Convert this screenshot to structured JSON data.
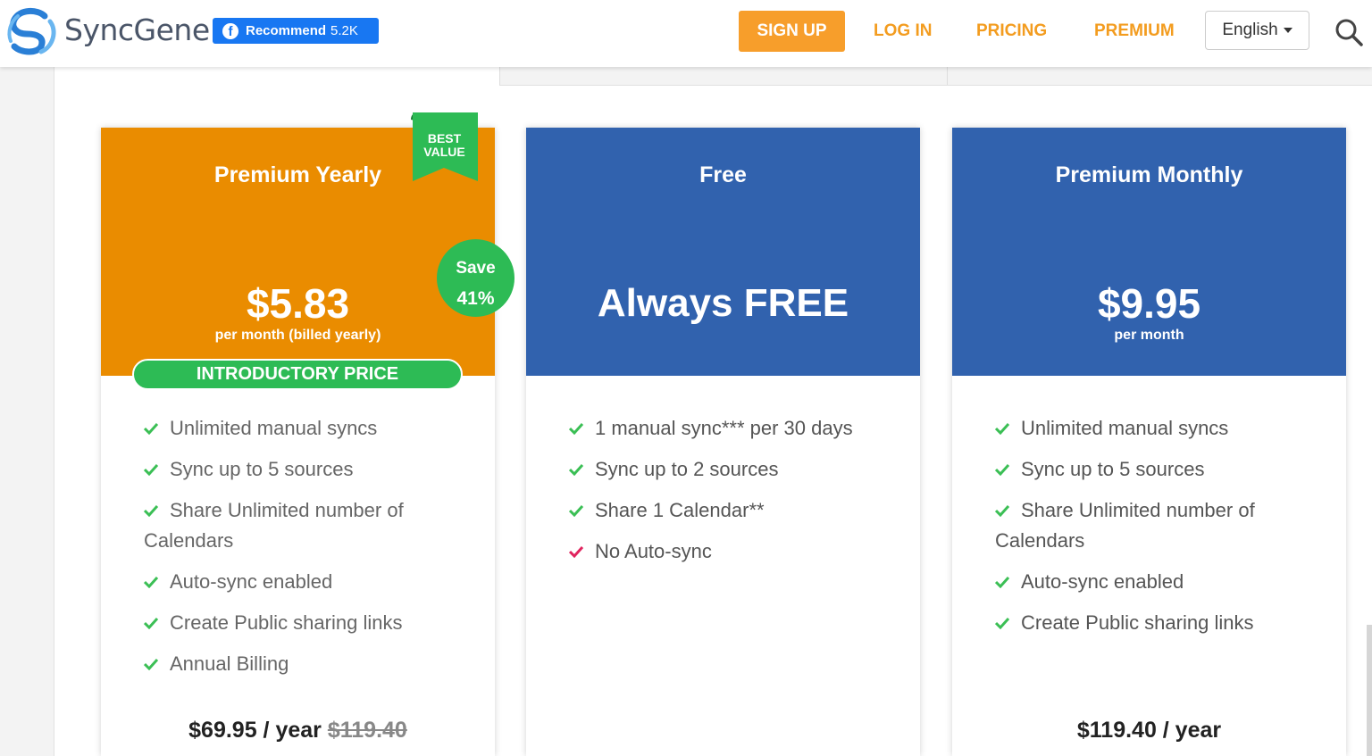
{
  "header": {
    "brand": "SyncGene",
    "recommend_label": "Recommend",
    "recommend_count": "5.2K",
    "signup_label": "SIGN UP",
    "login_label": "LOG IN",
    "pricing_label": "PRICING",
    "premium_label": "PREMIUM",
    "language": "English"
  },
  "colors": {
    "orange_card": "#ea8c00",
    "blue_card": "#3162ae",
    "nav_orange": "#f39c1f",
    "green": "#2dbb55",
    "facebook_blue": "#1877f2"
  },
  "plans": [
    {
      "title": "Premium Yearly",
      "ribbon_line1": "BEST",
      "ribbon_line2": "VALUE",
      "save_line1": "Save",
      "save_line2": "41%",
      "price": "$5.83",
      "price_sub": "per month (billed yearly)",
      "intro_label": "INTRODUCTORY PRICE",
      "features": [
        "Unlimited manual syncs",
        "Sync up to 5 sources",
        "Share Unlimited number of",
        "Calendars",
        "Auto-sync enabled",
        "Create Public sharing links",
        "Annual Billing"
      ],
      "footer_price": "$69.95 / year",
      "footer_strike": "$119.40"
    },
    {
      "title": "Free",
      "price": "Always FREE",
      "features": [
        "1 manual sync*** per 30 days",
        "Sync up to 2 sources",
        "Share 1 Calendar**",
        "No Auto-sync"
      ]
    },
    {
      "title": "Premium Monthly",
      "price": "$9.95",
      "price_sub": "per month",
      "features": [
        "Unlimited manual syncs",
        "Sync up to 5 sources",
        "Share Unlimited number of",
        "Calendars",
        "Auto-sync enabled",
        "Create Public sharing links"
      ],
      "footer_price": "$119.40 / year"
    }
  ]
}
